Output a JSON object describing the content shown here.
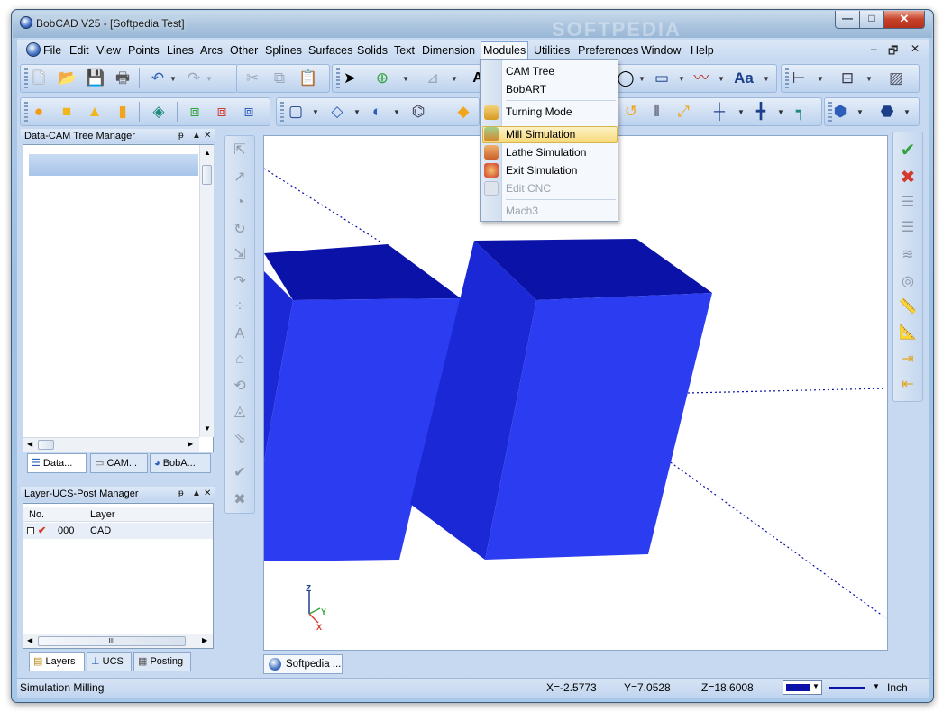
{
  "window": {
    "title": "BobCAD V25 - [Softpedia Test]",
    "controls": {
      "minimize": "—",
      "maximize": "□",
      "close": "✕"
    }
  },
  "menubar": {
    "items": [
      "File",
      "Edit",
      "View",
      "Points",
      "Lines",
      "Arcs",
      "Other",
      "Splines",
      "Surfaces",
      "Solids",
      "Text",
      "Dimension",
      "Modules",
      "Utilities",
      "Preferences",
      "Window",
      "Help"
    ],
    "active_item": "Modules",
    "mdi_controls": [
      "–",
      "🗗",
      "✕"
    ]
  },
  "modules_menu": {
    "items": [
      {
        "label": "CAM Tree",
        "enabled": true,
        "highlighted": false
      },
      {
        "label": "BobART",
        "enabled": true,
        "highlighted": false
      },
      {
        "label": "Turning Mode",
        "enabled": true,
        "highlighted": false
      },
      {
        "label": "Mill Simulation",
        "enabled": true,
        "highlighted": true
      },
      {
        "label": "Lathe Simulation",
        "enabled": true,
        "highlighted": false
      },
      {
        "label": "Exit Simulation",
        "enabled": true,
        "highlighted": false
      },
      {
        "label": "Edit CNC",
        "enabled": false,
        "highlighted": false
      },
      {
        "label": "Mach3",
        "enabled": false,
        "highlighted": false
      }
    ]
  },
  "toolbar_text": {
    "font_button": "Aa",
    "text_button_partial": "A"
  },
  "data_cam_panel": {
    "title": "Data-CAM Tree Manager",
    "header_controls": [
      "ᵽ",
      "▲",
      "✕"
    ],
    "tabs": [
      "Data...",
      "CAM...",
      "BobA..."
    ]
  },
  "layer_panel": {
    "title": "Layer-UCS-Post Manager",
    "header_controls": [
      "ᵽ",
      "▲",
      "✕"
    ],
    "columns": [
      "No.",
      "Layer"
    ],
    "rows": [
      {
        "no": "000",
        "layer": "CAD",
        "visible": true
      }
    ],
    "hscroll_thumb": "III",
    "tabs": [
      "Layers",
      "UCS",
      "Posting"
    ]
  },
  "document_tab": {
    "label": "Softpedia ..."
  },
  "viewport": {
    "axes": {
      "x": "X",
      "y": "Y",
      "z": "Z"
    },
    "watermark": "SOFTPEDIA",
    "solid_colors": {
      "top": "#0a12a8",
      "front": "#2c3cf0",
      "side": "#1a28d6"
    }
  },
  "statusbar": {
    "message": "Simulation Milling",
    "x": "X=-2.5773",
    "y": "Y=7.0528",
    "z": "Z=18.6008",
    "units": "Inch"
  },
  "icons": {
    "accent": "#2d5fb8",
    "check_color": "#2fa23a",
    "cross_color": "#d23a2c"
  }
}
